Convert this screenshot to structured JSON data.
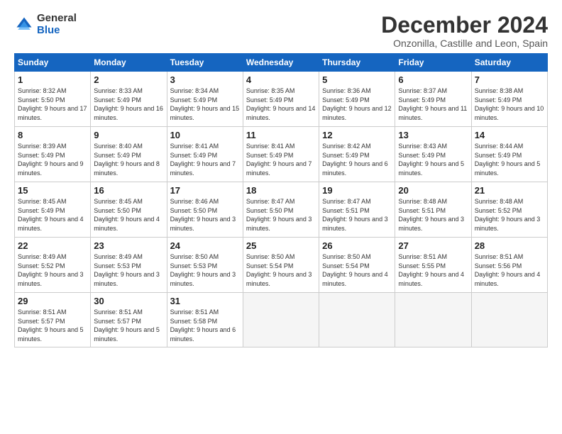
{
  "logo": {
    "general": "General",
    "blue": "Blue"
  },
  "title": {
    "month_year": "December 2024",
    "location": "Onzonilla, Castille and Leon, Spain"
  },
  "days_of_week": [
    "Sunday",
    "Monday",
    "Tuesday",
    "Wednesday",
    "Thursday",
    "Friday",
    "Saturday"
  ],
  "weeks": [
    [
      {
        "day": "1",
        "sunrise": "8:32 AM",
        "sunset": "5:50 PM",
        "daylight": "9 hours and 17 minutes."
      },
      {
        "day": "2",
        "sunrise": "8:33 AM",
        "sunset": "5:49 PM",
        "daylight": "9 hours and 16 minutes."
      },
      {
        "day": "3",
        "sunrise": "8:34 AM",
        "sunset": "5:49 PM",
        "daylight": "9 hours and 15 minutes."
      },
      {
        "day": "4",
        "sunrise": "8:35 AM",
        "sunset": "5:49 PM",
        "daylight": "9 hours and 14 minutes."
      },
      {
        "day": "5",
        "sunrise": "8:36 AM",
        "sunset": "5:49 PM",
        "daylight": "9 hours and 12 minutes."
      },
      {
        "day": "6",
        "sunrise": "8:37 AM",
        "sunset": "5:49 PM",
        "daylight": "9 hours and 11 minutes."
      },
      {
        "day": "7",
        "sunrise": "8:38 AM",
        "sunset": "5:49 PM",
        "daylight": "9 hours and 10 minutes."
      }
    ],
    [
      {
        "day": "8",
        "sunrise": "8:39 AM",
        "sunset": "5:49 PM",
        "daylight": "9 hours and 9 minutes."
      },
      {
        "day": "9",
        "sunrise": "8:40 AM",
        "sunset": "5:49 PM",
        "daylight": "9 hours and 8 minutes."
      },
      {
        "day": "10",
        "sunrise": "8:41 AM",
        "sunset": "5:49 PM",
        "daylight": "9 hours and 7 minutes."
      },
      {
        "day": "11",
        "sunrise": "8:41 AM",
        "sunset": "5:49 PM",
        "daylight": "9 hours and 7 minutes."
      },
      {
        "day": "12",
        "sunrise": "8:42 AM",
        "sunset": "5:49 PM",
        "daylight": "9 hours and 6 minutes."
      },
      {
        "day": "13",
        "sunrise": "8:43 AM",
        "sunset": "5:49 PM",
        "daylight": "9 hours and 5 minutes."
      },
      {
        "day": "14",
        "sunrise": "8:44 AM",
        "sunset": "5:49 PM",
        "daylight": "9 hours and 5 minutes."
      }
    ],
    [
      {
        "day": "15",
        "sunrise": "8:45 AM",
        "sunset": "5:49 PM",
        "daylight": "9 hours and 4 minutes."
      },
      {
        "day": "16",
        "sunrise": "8:45 AM",
        "sunset": "5:50 PM",
        "daylight": "9 hours and 4 minutes."
      },
      {
        "day": "17",
        "sunrise": "8:46 AM",
        "sunset": "5:50 PM",
        "daylight": "9 hours and 3 minutes."
      },
      {
        "day": "18",
        "sunrise": "8:47 AM",
        "sunset": "5:50 PM",
        "daylight": "9 hours and 3 minutes."
      },
      {
        "day": "19",
        "sunrise": "8:47 AM",
        "sunset": "5:51 PM",
        "daylight": "9 hours and 3 minutes."
      },
      {
        "day": "20",
        "sunrise": "8:48 AM",
        "sunset": "5:51 PM",
        "daylight": "9 hours and 3 minutes."
      },
      {
        "day": "21",
        "sunrise": "8:48 AM",
        "sunset": "5:52 PM",
        "daylight": "9 hours and 3 minutes."
      }
    ],
    [
      {
        "day": "22",
        "sunrise": "8:49 AM",
        "sunset": "5:52 PM",
        "daylight": "9 hours and 3 minutes."
      },
      {
        "day": "23",
        "sunrise": "8:49 AM",
        "sunset": "5:53 PM",
        "daylight": "9 hours and 3 minutes."
      },
      {
        "day": "24",
        "sunrise": "8:50 AM",
        "sunset": "5:53 PM",
        "daylight": "9 hours and 3 minutes."
      },
      {
        "day": "25",
        "sunrise": "8:50 AM",
        "sunset": "5:54 PM",
        "daylight": "9 hours and 3 minutes."
      },
      {
        "day": "26",
        "sunrise": "8:50 AM",
        "sunset": "5:54 PM",
        "daylight": "9 hours and 4 minutes."
      },
      {
        "day": "27",
        "sunrise": "8:51 AM",
        "sunset": "5:55 PM",
        "daylight": "9 hours and 4 minutes."
      },
      {
        "day": "28",
        "sunrise": "8:51 AM",
        "sunset": "5:56 PM",
        "daylight": "9 hours and 4 minutes."
      }
    ],
    [
      {
        "day": "29",
        "sunrise": "8:51 AM",
        "sunset": "5:57 PM",
        "daylight": "9 hours and 5 minutes."
      },
      {
        "day": "30",
        "sunrise": "8:51 AM",
        "sunset": "5:57 PM",
        "daylight": "9 hours and 5 minutes."
      },
      {
        "day": "31",
        "sunrise": "8:51 AM",
        "sunset": "5:58 PM",
        "daylight": "9 hours and 6 minutes."
      },
      null,
      null,
      null,
      null
    ]
  ]
}
